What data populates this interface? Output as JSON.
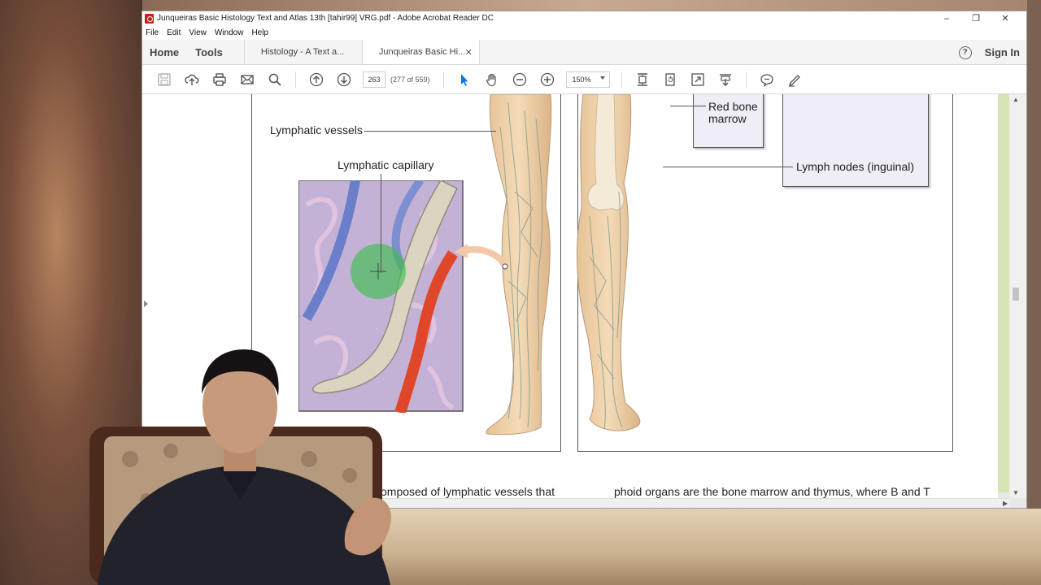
{
  "window": {
    "title": "Junqueiras Basic Histology Text and Atlas 13th [tahir99] VRG.pdf - Adobe Acrobat Reader DC",
    "controls": [
      "–",
      "❐",
      "✕"
    ]
  },
  "menu": {
    "items": [
      "File",
      "Edit",
      "View",
      "Window",
      "Help"
    ]
  },
  "tabs": {
    "home": "Home",
    "tools": "Tools",
    "docs": [
      {
        "label": "Histology - A Text a...",
        "active": false
      },
      {
        "label": "Junqueiras Basic Hi...",
        "active": true
      }
    ],
    "close_glyph": "✕",
    "help": "?",
    "sign_in": "Sign In"
  },
  "toolbar": {
    "page_current": "263",
    "page_count": "(277 of 559)",
    "zoom": "150%"
  },
  "figure": {
    "labels": {
      "lymphatic_vessels": "Lymphatic vessels",
      "lymphatic_capillary": "Lymphatic capillary",
      "red_bone_marrow": "Red bone marrow",
      "lymph_nodes": "Lymph nodes (inguinal)"
    }
  },
  "text": {
    "left_col": "omposed of lymphatic vessels that",
    "right_col": "phoid organs are the bone marrow and thymus, where B and T"
  },
  "colors": {
    "acrobat_red": "#c8201a",
    "tool_blue": "#1473e6",
    "scroll_green": "#d9e4b4"
  }
}
